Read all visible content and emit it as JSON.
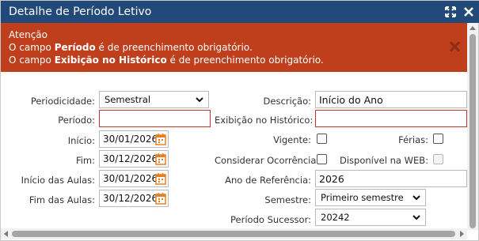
{
  "window": {
    "title": "Detalhe de Período Letivo"
  },
  "alert": {
    "heading": "Atenção",
    "line1": {
      "prefix": "O campo ",
      "field": "Período",
      "suffix": " é de preenchimento obrigatório."
    },
    "line2": {
      "prefix": "O campo ",
      "field": "Exibição no Histórico",
      "suffix": " é de preenchimento obrigatório."
    }
  },
  "form": {
    "periodicidade": {
      "label": "Periodicidade:",
      "value": "Semestral"
    },
    "periodo": {
      "label": "Período:",
      "value": ""
    },
    "inicio": {
      "label": "Início:",
      "value": "30/01/2026"
    },
    "fim": {
      "label": "Fim:",
      "value": "30/12/2026"
    },
    "inicio_aulas": {
      "label": "Início das Aulas:",
      "value": "30/01/2026"
    },
    "fim_aulas": {
      "label": "Fim das Aulas:",
      "value": "30/12/2026"
    },
    "descricao": {
      "label": "Descrição:",
      "value": "Início do Ano"
    },
    "exibicao_historico": {
      "label": "Exibição no Histórico:",
      "value": ""
    },
    "vigente": {
      "label": "Vigente:",
      "checked": false
    },
    "ferias": {
      "label": "Férias:",
      "checked": false
    },
    "considerar_ocorrencia": {
      "label": "Considerar Ocorrência:",
      "checked": false
    },
    "disponivel_web": {
      "label": "Disponível na WEB:",
      "checked": false,
      "disabled": true
    },
    "ano_referencia": {
      "label": "Ano de Referência:",
      "value": "2026"
    },
    "semestre": {
      "label": "Semestre:",
      "value": "Primeiro semestre"
    },
    "periodo_sucessor": {
      "label": "Período Sucessor:",
      "value": "20242"
    }
  },
  "colors": {
    "titlebar": "#21497a",
    "alert": "#bf3f1d",
    "required_border": "#c0392b",
    "calendar_icon": "#e67e22"
  },
  "icons": {
    "window_resize": "expand-icon",
    "window_close": "close-icon",
    "alert_close": "close-icon",
    "date_picker": "calendar-icon",
    "dropdown": "chevron-down-icon"
  }
}
